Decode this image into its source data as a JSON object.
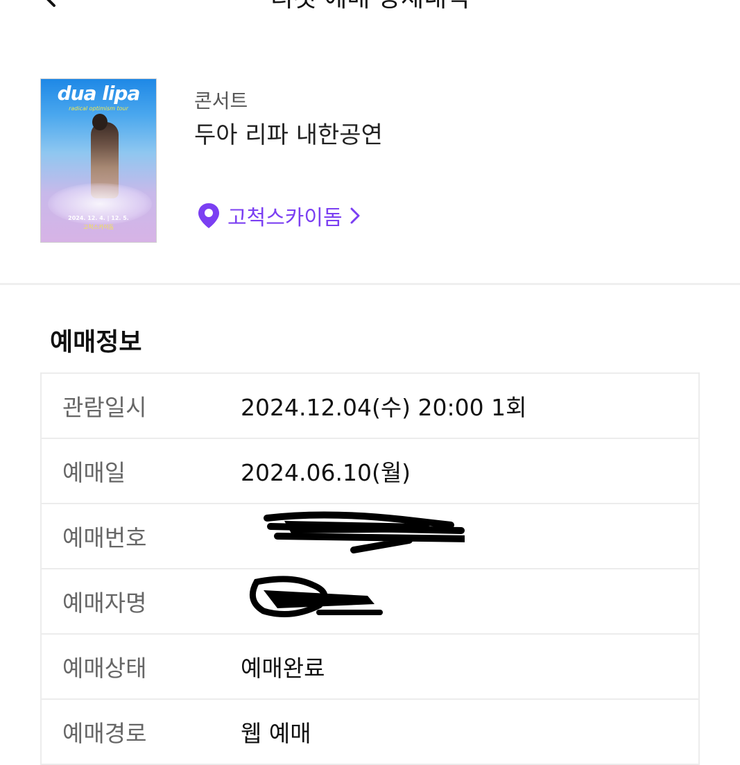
{
  "header": {
    "title": "티켓 예매 상세내역",
    "back_icon": "chevron-left-icon"
  },
  "event": {
    "poster": {
      "logo_text": "dua lipa",
      "subtitle": "radical optimism tour",
      "date": "2024. 12. 4. | 12. 5.",
      "venue": "고척스카이돔"
    },
    "category": "콘서트",
    "name": "두아 리파 내한공연",
    "venue_link": {
      "label": "고척스카이돔",
      "icon": "location-pin-icon",
      "color": "#7b3ff2"
    }
  },
  "booking_info": {
    "title": "예매정보",
    "rows": [
      {
        "label": "관람일시",
        "value": "2024.12.04(수) 20:00 1회"
      },
      {
        "label": "예매일",
        "value": "2024.06.10(월)"
      },
      {
        "label": "예매번호",
        "value": ""
      },
      {
        "label": "예매자명",
        "value": ""
      },
      {
        "label": "예매상태",
        "value": "예매완료"
      },
      {
        "label": "예매경로",
        "value": "웹 예매"
      }
    ]
  }
}
